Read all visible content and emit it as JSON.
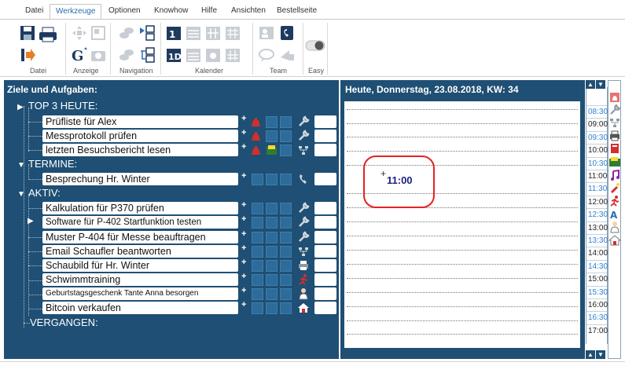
{
  "menu": {
    "tabs": [
      "Datei",
      "Werkzeuge",
      "Optionen",
      "Knowhow",
      "Hilfe",
      "Ansichten",
      "Bestellseite"
    ],
    "active_tab": "Werkzeuge"
  },
  "ribbon": {
    "groups": [
      "Datei",
      "Anzeige",
      "Navigation",
      "Kalender",
      "Team",
      "Easy"
    ]
  },
  "left_panel": {
    "title": "Ziele und Aufgaben:",
    "sections": {
      "top3": "TOP 3 HEUTE:",
      "termine": "TERMINE:",
      "aktiv": "AKTIV:",
      "vergangen": "VERGANGEN:"
    },
    "tasks": [
      {
        "label": "Prüfliste für Alex",
        "icon": "wrench-icon"
      },
      {
        "label": "Messprotokoll prüfen",
        "icon": "wrench-icon"
      },
      {
        "label": "letzten Besuchsbericht lesen",
        "icon": "network-icon"
      },
      {
        "label": "Besprechung Hr. Winter",
        "icon": "phone-icon"
      },
      {
        "label": "Kalkulation für P370 prüfen",
        "icon": "wrench-icon"
      },
      {
        "label": "Software für P-402 Startfunktion testen",
        "icon": "wrench-icon"
      },
      {
        "label": "Muster P-404 für Messe beauftragen",
        "icon": "wrench-icon"
      },
      {
        "label": "Email Schaufler beantworten",
        "icon": "network-icon"
      },
      {
        "label": "Schaubild für Hr. Winter",
        "icon": "printer-icon"
      },
      {
        "label": "Schwimmtraining",
        "icon": "runner-icon"
      },
      {
        "label": "Geburtstagsgeschenk Tante Anna besorgen",
        "icon": "person-icon"
      },
      {
        "label": "Bitcoin verkaufen",
        "icon": "house-icon"
      }
    ]
  },
  "right_panel": {
    "title": "Heute, Donnerstag, 23.08.2018, KW: 34",
    "cursor_time": "11:00"
  },
  "timeline": {
    "labels": [
      "08:30",
      "09:00",
      "09:30",
      "10:00",
      "10:30",
      "11:00",
      "11:30",
      "12:00",
      "12:30",
      "13:00",
      "13:30",
      "14:00",
      "14:30",
      "15:00",
      "15:30",
      "16:00",
      "16:30",
      "17:00"
    ]
  },
  "colors": {
    "panel_bg": "#1f4f74",
    "accent_blue": "#2b6cb0",
    "half_hour": "#2f7fd0",
    "highlight": "#e52222",
    "warning_red": "#d32f2f"
  }
}
